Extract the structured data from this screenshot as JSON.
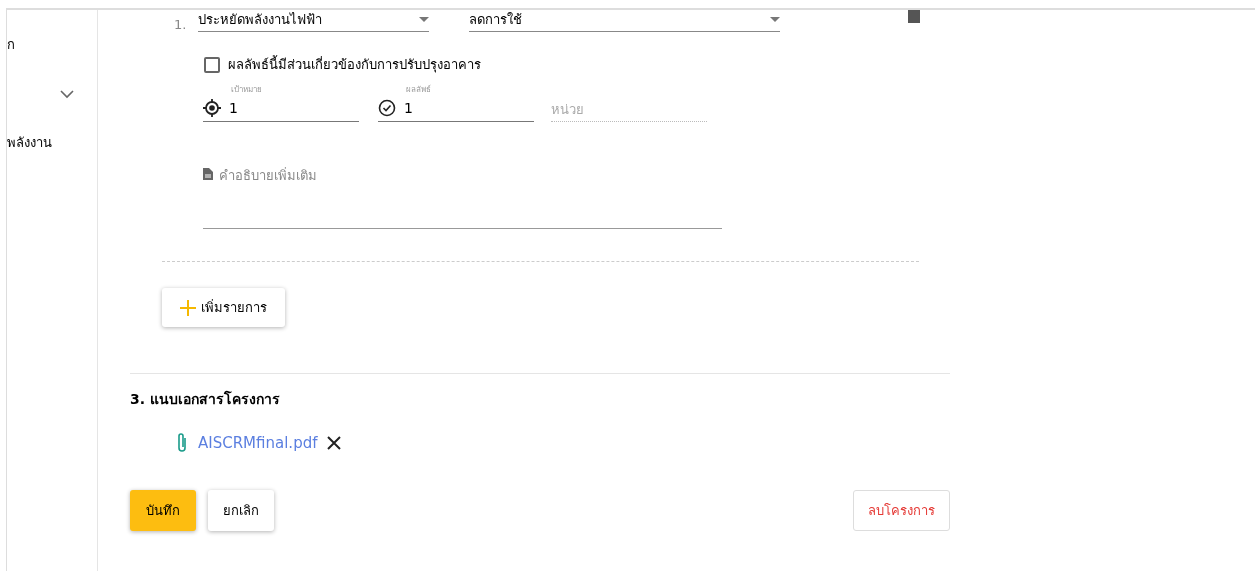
{
  "sidebar": {
    "items": [
      {
        "label": "ก"
      },
      {
        "label": "พลังงาน"
      }
    ]
  },
  "outcome": {
    "number": "1.",
    "category": "ประหยัดพลังงานไฟฟ้า",
    "type": "ลดการใช้",
    "building_related": {
      "label": "ผลลัพธ์นี้มีส่วนเกี่ยวข้องกับการปรับปรุงอาคาร",
      "checked": false
    },
    "target": {
      "label": "เป้าหมาย",
      "value": "1"
    },
    "result": {
      "label": "ผลลัพธ์",
      "value": "1"
    },
    "unit": {
      "placeholder": "หน่วย"
    },
    "description": {
      "placeholder": "คำอธิบายเพิ่มเติม"
    }
  },
  "add_button": "เพิ่มรายการ",
  "attachments": {
    "heading": "3. แนบเอกสารโครงการ",
    "files": [
      "AISCRMfinal.pdf"
    ]
  },
  "buttons": {
    "save": "บันทึก",
    "cancel": "ยกเลิก",
    "delete": "ลบโครงการ"
  }
}
